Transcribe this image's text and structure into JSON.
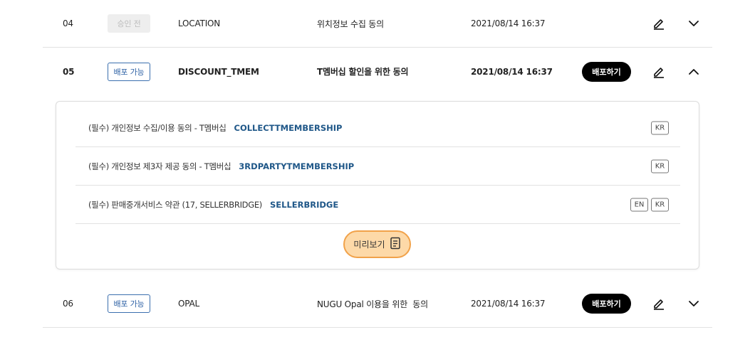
{
  "rows": [
    {
      "num": "04",
      "status": "승인 전",
      "key": "LOCATION",
      "desc": "위치정보 수집 동의",
      "date": "2021/08/14 16:37",
      "deploy": "",
      "expanded": false
    },
    {
      "num": "05",
      "status": "배포 가능",
      "key": "DISCOUNT_TMEM",
      "desc": "T멤버십 할인을 위한 동의",
      "date": "2021/08/14 16:37",
      "deploy": "배포하기",
      "expanded": true
    },
    {
      "num": "06",
      "status": "배포 가능",
      "key": "OPAL",
      "desc": "NUGU Opal 이용을 위한  동의",
      "date": "2021/08/14 16:37",
      "deploy": "배포하기",
      "expanded": false
    }
  ],
  "panel": {
    "items": [
      {
        "title": "(필수) 개인정보 수집/이용 동의 - T멤버십",
        "code": "COLLECTTMEMBERSHIP",
        "langs": [
          "KR"
        ]
      },
      {
        "title": "(필수) 개인정보 제3자 제공 동의 - T멤버십",
        "code": "3RDPARTYTMEMBERSHIP",
        "langs": [
          "KR"
        ]
      },
      {
        "title": "(필수) 판매중개서비스 약관 (17, SELLERBRIDGE)",
        "code": "SELLERBRIDGE",
        "langs": [
          "EN",
          "KR"
        ]
      }
    ],
    "preview_label": "미리보기"
  },
  "icons": {
    "edit": "pencil-edit-icon",
    "expand": "chevron-down-icon",
    "collapse": "chevron-up-icon",
    "document": "document-icon"
  },
  "colors": {
    "code_text": "#1f5788",
    "badge_border": "#3b6fae",
    "deploy_button": "#000000",
    "preview_fill": "#fdd9a8",
    "preview_border": "#f1a24a"
  }
}
